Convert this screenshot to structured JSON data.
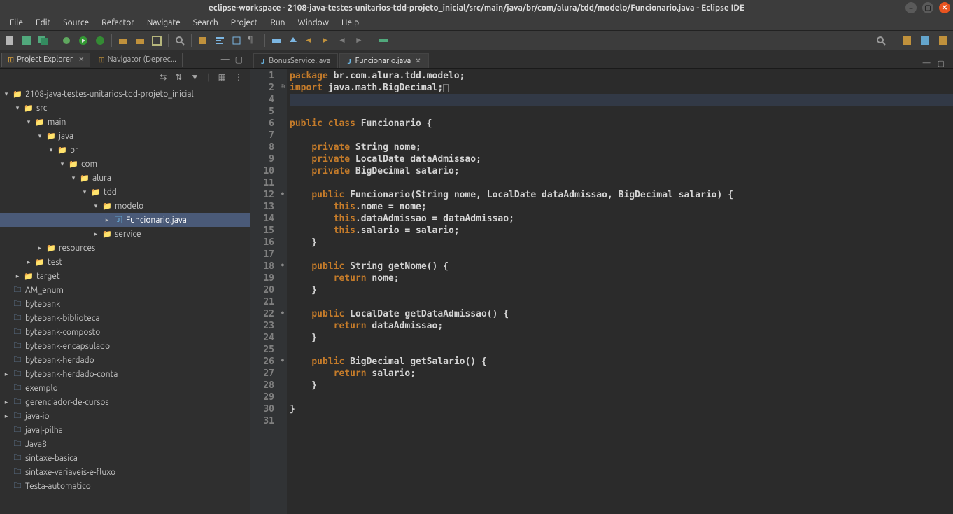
{
  "title": "eclipse-workspace - 2108-java-testes-unitarios-tdd-projeto_inicial/src/main/java/br/com/alura/tdd/modelo/Funcionario.java - Eclipse IDE",
  "menu": [
    "File",
    "Edit",
    "Source",
    "Refactor",
    "Navigate",
    "Search",
    "Project",
    "Run",
    "Window",
    "Help"
  ],
  "views": {
    "project_explorer": "Project Explorer",
    "navigator": "Navigator (Deprec..."
  },
  "tree": {
    "root": "2108-java-testes-unitarios-tdd-projeto_inicial",
    "src": "src",
    "main": "main",
    "java": "java",
    "br": "br",
    "com": "com",
    "alura": "alura",
    "tdd": "tdd",
    "modelo": "modelo",
    "funcionario": "Funcionario.java",
    "service": "service",
    "resources": "resources",
    "test": "test",
    "target": "target",
    "am_enum": "AM_enum",
    "bytebank": "bytebank",
    "bytebank_biblioteca": "bytebank-biblioteca",
    "bytebank_composto": "bytebank-composto",
    "bytebank_encapsulado": "bytebank-encapsulado",
    "bytebank_herdado": "bytebank-herdado",
    "bytebank_herdado_conta": "bytebank-herdado-conta",
    "exemplo": "exemplo",
    "gerenciador": "gerenciador-de-cursos",
    "java_io": "java-io",
    "java_pilha": "java|-pilha",
    "java8": "Java8",
    "sintaxe_basica": "sintaxe-basica",
    "sintaxe_variaveis": "sintaxe-variaveis-e-fluxo",
    "testa": "Testa-automatico"
  },
  "editor_tabs": {
    "bonus": "BonusService.java",
    "funcionario": "Funcionario.java"
  },
  "code": {
    "l1_a": "package",
    "l1_b": " br.com.alura.tdd.modelo;",
    "l2_a": "import",
    "l2_b": " java.math.BigDecimal;",
    "l6_a": "public",
    "l6_b": "class",
    "l6_c": " Funcionario {",
    "l8_a": "private",
    "l8_b": " String nome;",
    "l9_a": "private",
    "l9_b": " LocalDate dataAdmissao;",
    "l10_a": "private",
    "l10_b": " BigDecimal salario;",
    "l12_a": "public",
    "l12_b": " Funcionario(String nome, LocalDate dataAdmissao, BigDecimal salario) {",
    "l13_a": "this",
    "l13_b": ".nome = nome;",
    "l14_a": "this",
    "l14_b": ".dataAdmissao = dataAdmissao;",
    "l15_a": "this",
    "l15_b": ".salario = salario;",
    "l16": "    }",
    "l18_a": "public",
    "l18_b": " String getNome() {",
    "l19_a": "return",
    "l19_b": " nome;",
    "l20": "    }",
    "l22_a": "public",
    "l22_b": " LocalDate getDataAdmissao() {",
    "l23_a": "return",
    "l23_b": " dataAdmissao;",
    "l24": "    }",
    "l26_a": "public",
    "l26_b": " BigDecimal getSalario() {",
    "l27_a": "return",
    "l27_b": " salario;",
    "l28": "    }",
    "l30": "}"
  },
  "line_numbers": [
    "1",
    "2",
    "4",
    "5",
    "6",
    "7",
    "8",
    "9",
    "10",
    "11",
    "12",
    "13",
    "14",
    "15",
    "16",
    "17",
    "18",
    "19",
    "20",
    "21",
    "22",
    "23",
    "24",
    "25",
    "26",
    "27",
    "28",
    "29",
    "30",
    "31"
  ]
}
